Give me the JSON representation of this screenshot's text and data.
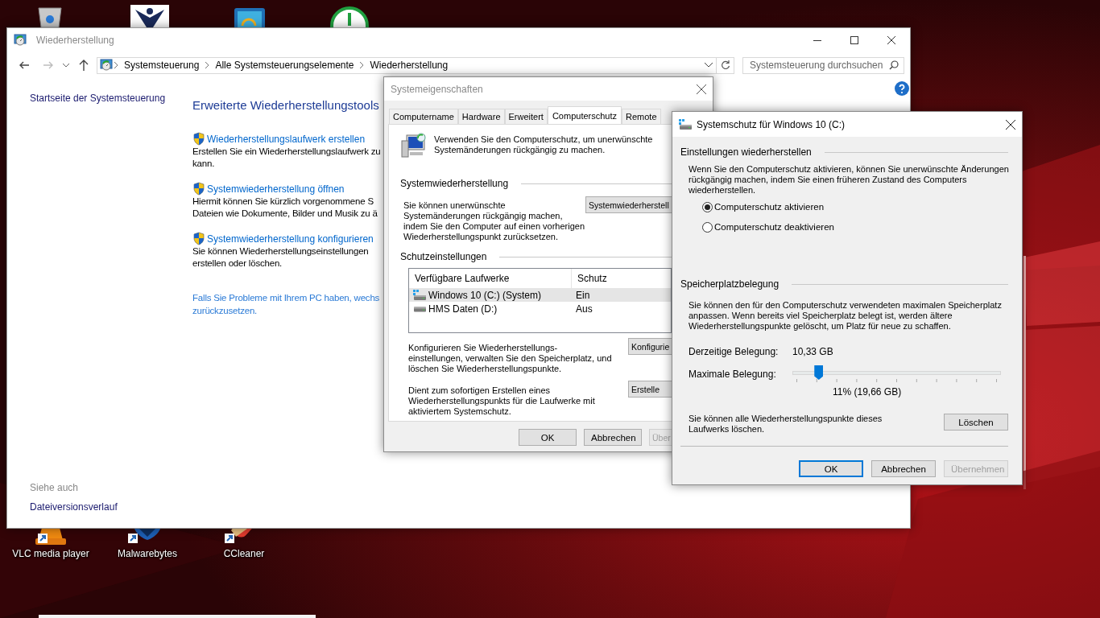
{
  "desktop_icons": [
    {
      "label": "VLC media player",
      "kind": "cone"
    },
    {
      "label": "Malwarebytes",
      "kind": "shield"
    },
    {
      "label": "CCleaner",
      "kind": "brush"
    }
  ],
  "main_window": {
    "title": "Wiederherstellung",
    "navigation": {
      "back_disabled": false,
      "forward_disabled": true
    },
    "address": [
      "Systemsteuerung",
      "Alle Systemsteuerungselemente",
      "Wiederherstellung"
    ],
    "search": {
      "placeholder": "Systemsteuerung durchsuchen"
    },
    "sidebar": {
      "home_link": "Startseite der Systemsteuerung",
      "see_also_label": "Siehe auch",
      "see_also_links": [
        "Dateiversionsverlauf"
      ]
    },
    "content": {
      "heading": "Erweiterte Wiederherstellungstools",
      "tasks": [
        {
          "link": "Wiederherstellungslaufwerk erstellen",
          "description": "Erstellen Sie ein Wiederherstellungslaufwerk zu\nkann."
        },
        {
          "link": "Systemwiederherstellung öffnen",
          "description": "Hiermit können Sie kürzlich vorgenommene S\nDateien wie Dokumente, Bilder und Musik zu ä"
        },
        {
          "link": "Systemwiederherstellung konfigurieren",
          "description": "Sie können Wiederherstellungseinstellungen\nerstellen oder löschen."
        }
      ],
      "footer_link": "Falls Sie Probleme mit Ihrem PC haben, wechs\nzurückzusetzen."
    }
  },
  "system_properties": {
    "title": "Systemeigenschaften",
    "tabs": [
      {
        "label": "Computername",
        "selected": false
      },
      {
        "label": "Hardware",
        "selected": false
      },
      {
        "label": "Erweitert",
        "selected": false
      },
      {
        "label": "Computerschutz",
        "selected": true
      },
      {
        "label": "Remote",
        "selected": false
      }
    ],
    "intro": "Verwenden Sie den Computerschutz, um unerwünschte\nSystemänderungen rückgängig zu machen.",
    "restore_group": "Systemwiederherstellung",
    "restore_text": "Sie können unerwünschte\nSystemänderungen rückgängig machen,\nindem Sie den Computer auf einen vorherigen\nWiederherstellungspunkt zurücksetzen.",
    "restore_button": "Systemwiederherstell",
    "protection_group": "Schutzeinstellungen",
    "drives": {
      "columns": [
        "Verfügbare Laufwerke",
        "Schutz"
      ],
      "rows": [
        {
          "name": "Windows 10 (C:) (System)",
          "protection": "Ein",
          "kind": "system",
          "selected": true
        },
        {
          "name": "HMS Daten (D:)",
          "protection": "Aus",
          "kind": "data",
          "selected": false
        }
      ]
    },
    "configure_text": "Konfigurieren Sie Wiederherstellungs-\neinstellungen, verwalten Sie den Speicherplatz, und\nlöschen Sie Wiederherstellungspunkte.",
    "configure_button": "Konfigurie",
    "create_text": "Dient zum sofortigen Erstellen eines\nWiederherstellungspunkts für die Laufwerke mit\naktiviertem Systemschutz.",
    "create_button": "Erstelle",
    "buttons": [
      {
        "label": "OK",
        "disabled": false
      },
      {
        "label": "Abbrechen",
        "disabled": false
      },
      {
        "label": "Über",
        "disabled": true
      }
    ]
  },
  "system_protection": {
    "title": "Systemschutz für Windows 10 (C:)",
    "restore_group": "Einstellungen wiederherstellen",
    "restore_text": "Wenn Sie den Computerschutz aktivieren, können Sie unerwünschte Änderungen\nrückgängig machen, indem Sie einen früheren Zustand des Computers\nwiederherstellen.",
    "options": [
      {
        "label": "Computerschutz aktivieren",
        "selected": true
      },
      {
        "label": "Computerschutz deaktivieren",
        "selected": false
      }
    ],
    "usage_group": "Speicherplatzbelegung",
    "usage_text": "Sie können den für den Computerschutz verwendeten maximalen Speicherplatz\nanpassen. Wenn bereits viel Speicherplatz belegt ist, werden ältere\nWiederherstellungspunkte gelöscht, um Platz für neue zu schaffen.",
    "current_label": "Derzeitige Belegung:",
    "current_value": "10,33 GB",
    "max_label": "Maximale Belegung:",
    "level": 0.11,
    "reading": "11% (19,66 GB)",
    "delete_text": "Sie können alle Wiederherstellungspunkte dieses\nLaufwerks löschen.",
    "delete_button": "Löschen",
    "buttons": [
      {
        "label": "OK",
        "disabled": false,
        "default": true
      },
      {
        "label": "Abbrechen",
        "disabled": false,
        "default": false
      },
      {
        "label": "Übernehmen",
        "disabled": true,
        "default": false
      }
    ]
  }
}
